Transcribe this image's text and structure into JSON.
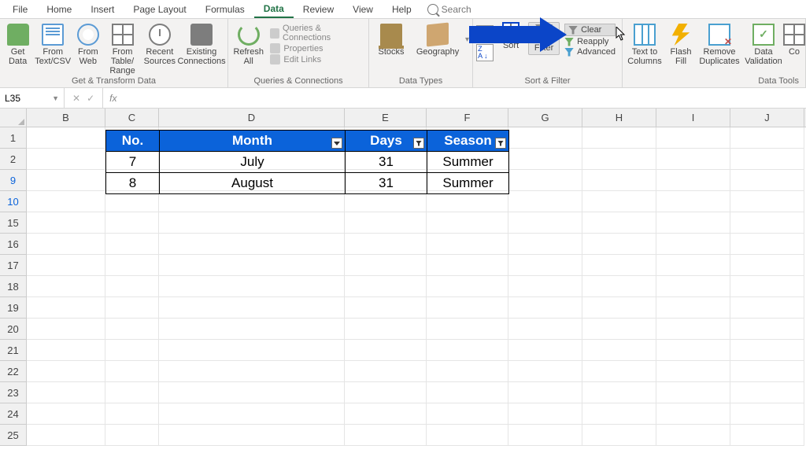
{
  "tabs": {
    "file": "File",
    "home": "Home",
    "insert": "Insert",
    "pagelayout": "Page Layout",
    "formulas": "Formulas",
    "data": "Data",
    "review": "Review",
    "view": "View",
    "help": "Help",
    "search": "Search"
  },
  "ribbon": {
    "groups": {
      "get_transform": "Get & Transform Data",
      "qc": "Queries & Connections",
      "datatypes": "Data Types",
      "sortfilter": "Sort & Filter",
      "datatools": "Data Tools"
    },
    "btn": {
      "get_data": "Get\nData",
      "from_text": "From\nText/CSV",
      "from_web": "From\nWeb",
      "from_table": "From Table/\nRange",
      "recent": "Recent\nSources",
      "existing": "Existing\nConnections",
      "refresh": "Refresh\nAll",
      "qc": "Queries & Connections",
      "props": "Properties",
      "editlinks": "Edit Links",
      "stocks": "Stocks",
      "geo": "Geography",
      "sort": "Sort",
      "filter": "Filter",
      "clear": "Clear",
      "reapply": "Reapply",
      "advanced": "Advanced",
      "ttc": "Text to\nColumns",
      "flash": "Flash\nFill",
      "dups": "Remove\nDuplicates",
      "dval": "Data\nValidation",
      "cons": "Co"
    }
  },
  "namebox": "L35",
  "formula": "",
  "columns": [
    "B",
    "C",
    "D",
    "E",
    "F",
    "G",
    "H",
    "I",
    "J"
  ],
  "visible_rows": [
    "1",
    "2",
    "9",
    "10",
    "15",
    "16",
    "17",
    "18",
    "19",
    "20",
    "21",
    "22",
    "23",
    "24",
    "25"
  ],
  "table": {
    "headers": {
      "no": "No.",
      "month": "Month",
      "days": "Days",
      "season": "Season"
    },
    "rows": [
      {
        "no": "7",
        "month": "July",
        "days": "31",
        "season": "Summer"
      },
      {
        "no": "8",
        "month": "August",
        "days": "31",
        "season": "Summer"
      }
    ]
  }
}
